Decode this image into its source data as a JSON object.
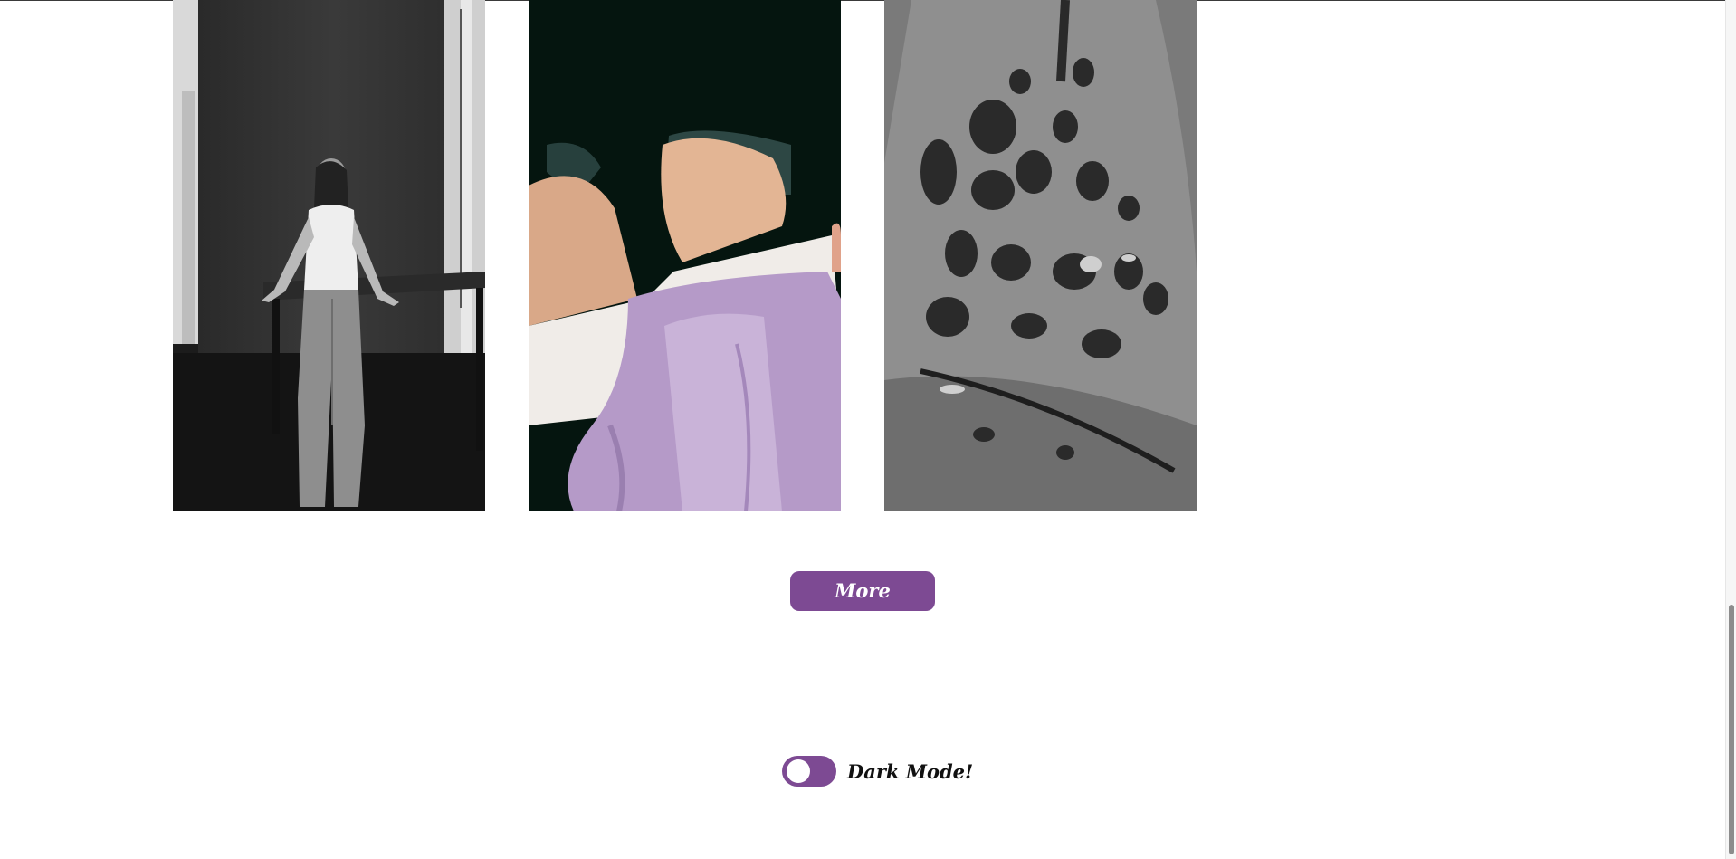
{
  "gallery": {
    "photos": [
      {
        "subject": "woman-leaning-on-table"
      },
      {
        "subject": "knees-lilac-skirt"
      },
      {
        "subject": "rock-texture"
      }
    ]
  },
  "more_button": {
    "label": "More"
  },
  "dark_mode": {
    "label": "Dark Mode!",
    "enabled": false
  },
  "colors": {
    "accent": "#7d4a93",
    "text": "#111111",
    "background": "#ffffff"
  }
}
